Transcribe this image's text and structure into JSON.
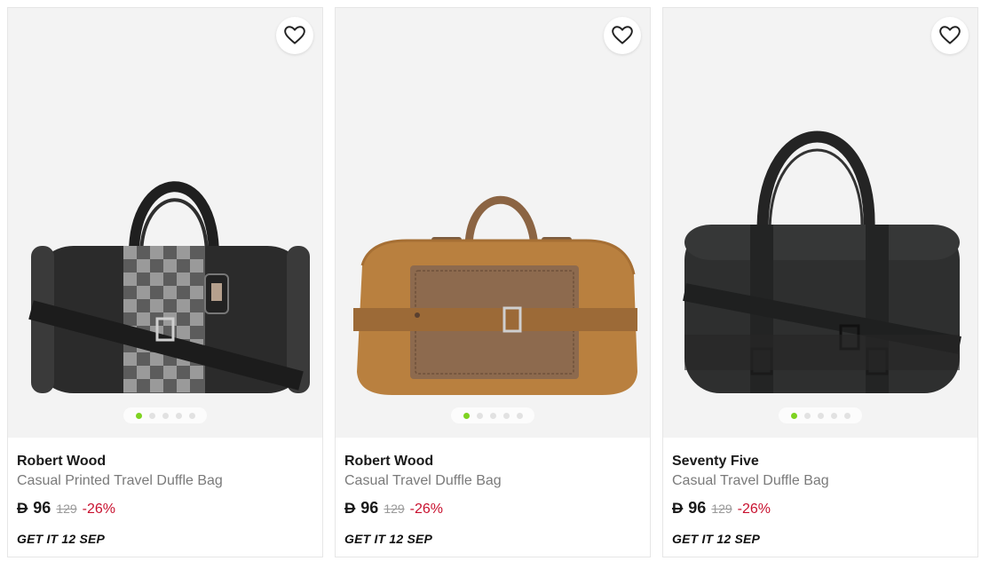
{
  "products": [
    {
      "brand": "Robert Wood",
      "title": "Casual Printed Travel Duffle Bag",
      "currency": "D",
      "price": "96",
      "old_price": "129",
      "discount": "-26%",
      "delivery": "GET IT 12 SEP",
      "image_dots": 5,
      "active_dot": 0,
      "bag_color": "#2b2b2b",
      "pattern_colors": [
        "#5c5c5c",
        "#9a9a9a"
      ]
    },
    {
      "brand": "Robert Wood",
      "title": "Casual Travel Duffle Bag",
      "currency": "D",
      "price": "96",
      "old_price": "129",
      "discount": "-26%",
      "delivery": "GET IT 12 SEP",
      "image_dots": 5,
      "active_dot": 0,
      "bag_color": "#b9803f",
      "pattern_colors": [
        "#8d6a4e",
        "#9c7458"
      ]
    },
    {
      "brand": "Seventy Five",
      "title": "Casual Travel Duffle Bag",
      "currency": "D",
      "price": "96",
      "old_price": "129",
      "discount": "-26%",
      "delivery": "GET IT 12 SEP",
      "image_dots": 5,
      "active_dot": 0,
      "bag_color": "#2e2f2f",
      "pattern_colors": [
        "#232424",
        "#3a3b3b"
      ]
    }
  ],
  "colors": {
    "discount": "#c8102e",
    "active_dot": "#7ed321",
    "image_bg": "#f3f3f3"
  },
  "icons": {
    "wishlist": "heart-outline-icon"
  }
}
